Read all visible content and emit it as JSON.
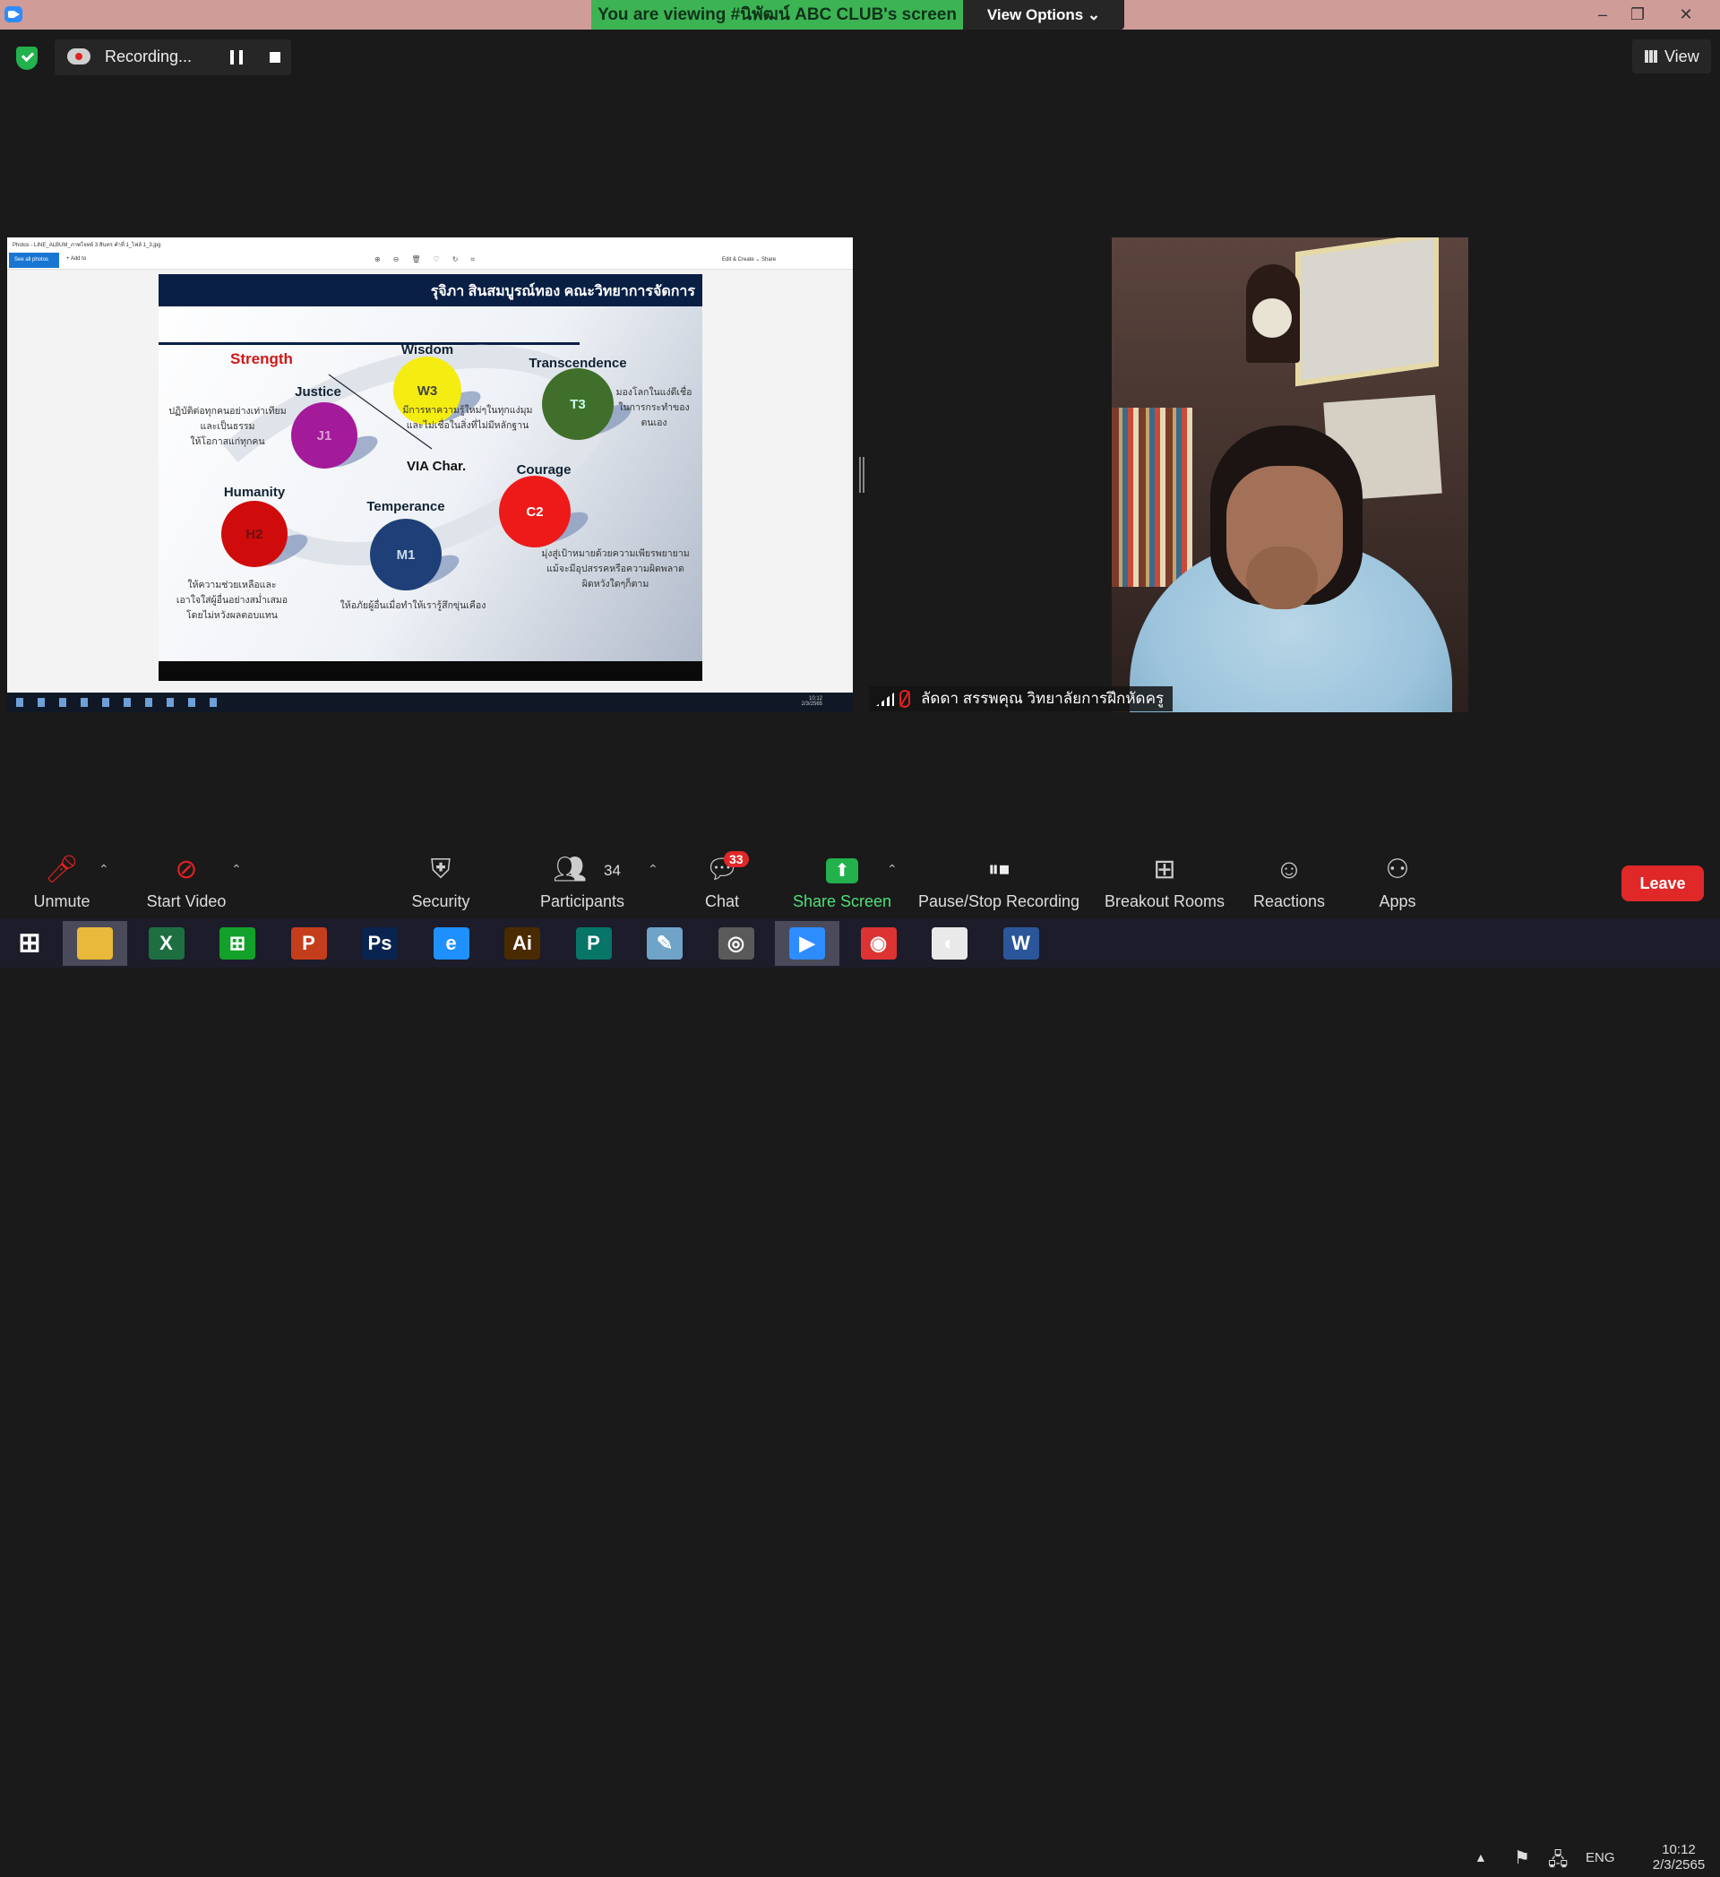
{
  "window": {
    "banner": "You are viewing #นิพัฒน์ ABC CLUB's screen",
    "view_options": "View Options",
    "minimize": "–",
    "restore": "❐",
    "close": "✕"
  },
  "recording": {
    "label": "Recording...",
    "view_label": "View"
  },
  "shared_screen": {
    "window_title": "Photos - LINE_ALBUM_ภาพโจทย์ 3 สินทร คำที่ 1_ไฟล์ 1_3.jpg",
    "see_all_photos": "See all photos",
    "add_to": "+ Add to",
    "edit_create": "Edit & Create ⌄   Share",
    "slide": {
      "header": "รุจิภา สินสมบูรณ์ทอง คณะวิทยาการจัดการ",
      "strength": "Strength",
      "center": "VIA Char.",
      "nodes": [
        {
          "id": "W3",
          "title": "Wisdom",
          "color": "#f5ec12",
          "text_color": "#444"
        },
        {
          "id": "T3",
          "title": "Transcendence",
          "color": "#3f6f2a",
          "text_color": "#cfe"
        },
        {
          "id": "J1",
          "title": "Justice",
          "color": "#a31a9a",
          "text_color": "#d9a0d6"
        },
        {
          "id": "C2",
          "title": "Courage",
          "color": "#ee1a1a",
          "text_color": "#fff"
        },
        {
          "id": "H2",
          "title": "Humanity",
          "color": "#d00b0b",
          "text_color": "#611"
        },
        {
          "id": "M1",
          "title": "Temperance",
          "color": "#1e3f78",
          "text_color": "#cde"
        }
      ],
      "desc_justice": [
        "ปฏิบัติต่อทุกคนอย่างเท่าเทียม",
        "และเป็นธรรม",
        "ให้โอกาสแก่ทุกคน"
      ],
      "desc_wisdom": [
        "มีการหาความรู้ใหม่ๆในทุกแง่มุม",
        "และไม่เชื่อในสิ่งที่ไม่มีหลักฐาน"
      ],
      "desc_transcendence": [
        "มองโลกในแง่ดีเชื่อ",
        "ในการกระทำของ",
        "ตนเอง"
      ],
      "desc_humanity": [
        "ให้ความช่วยเหลือและ",
        "เอาใจใส่ผู้อื่นอย่างสม่ำเสมอ",
        "โดยไม่หวังผลตอบแทน"
      ],
      "desc_temperance": [
        "ให้อภัยผู้อื่นเมื่อทำให้เรารู้สึกขุ่นเคือง"
      ],
      "desc_courage": [
        "มุ่งสู่เป้าหมายด้วยความเพียรพยายาม",
        "แม้จะมีอุปสรรคหรือความผิดพลาด",
        "ผิดหวังใดๆก็ตาม"
      ]
    },
    "clock_time": "10:12",
    "clock_date": "2/3/2565"
  },
  "video": {
    "participant_name": "ลัดดา สรรพคุณ วิทยาลัยการฝึกหัดครู"
  },
  "toolbar": {
    "unmute": "Unmute",
    "start_video": "Start Video",
    "security": "Security",
    "participants": "Participants",
    "participants_count": "34",
    "chat": "Chat",
    "chat_badge": "33",
    "share_screen": "Share Screen",
    "pause_stop": "Pause/Stop Recording",
    "breakout": "Breakout Rooms",
    "reactions": "Reactions",
    "apps": "Apps",
    "leave": "Leave"
  },
  "taskbar": {
    "apps": [
      {
        "name": "file-explorer",
        "glyph": "",
        "color": "#e8b93a"
      },
      {
        "name": "excel",
        "glyph": "X",
        "color": "#1d6f42"
      },
      {
        "name": "store",
        "glyph": "⊞",
        "color": "#12a12a"
      },
      {
        "name": "powerpoint",
        "glyph": "P",
        "color": "#c43e1c"
      },
      {
        "name": "photoshop",
        "glyph": "Ps",
        "color": "#0a2450"
      },
      {
        "name": "internet-explorer",
        "glyph": "e",
        "color": "#1e90ff"
      },
      {
        "name": "illustrator",
        "glyph": "Ai",
        "color": "#4a2a00"
      },
      {
        "name": "publisher",
        "glyph": "P",
        "color": "#077568"
      },
      {
        "name": "notepad",
        "glyph": "✎",
        "color": "#6fa3c8"
      },
      {
        "name": "photoscape",
        "glyph": "◎",
        "color": "#5a5a5a"
      },
      {
        "name": "zoom",
        "glyph": "▶",
        "color": "#2d8cff"
      },
      {
        "name": "chrome",
        "glyph": "◉",
        "color": "#d33"
      },
      {
        "name": "photos",
        "glyph": "◐",
        "color": "#e9e9e9"
      },
      {
        "name": "word",
        "glyph": "W",
        "color": "#2b579a"
      }
    ],
    "language": "ENG",
    "time": "10:12",
    "date": "2/3/2565"
  }
}
